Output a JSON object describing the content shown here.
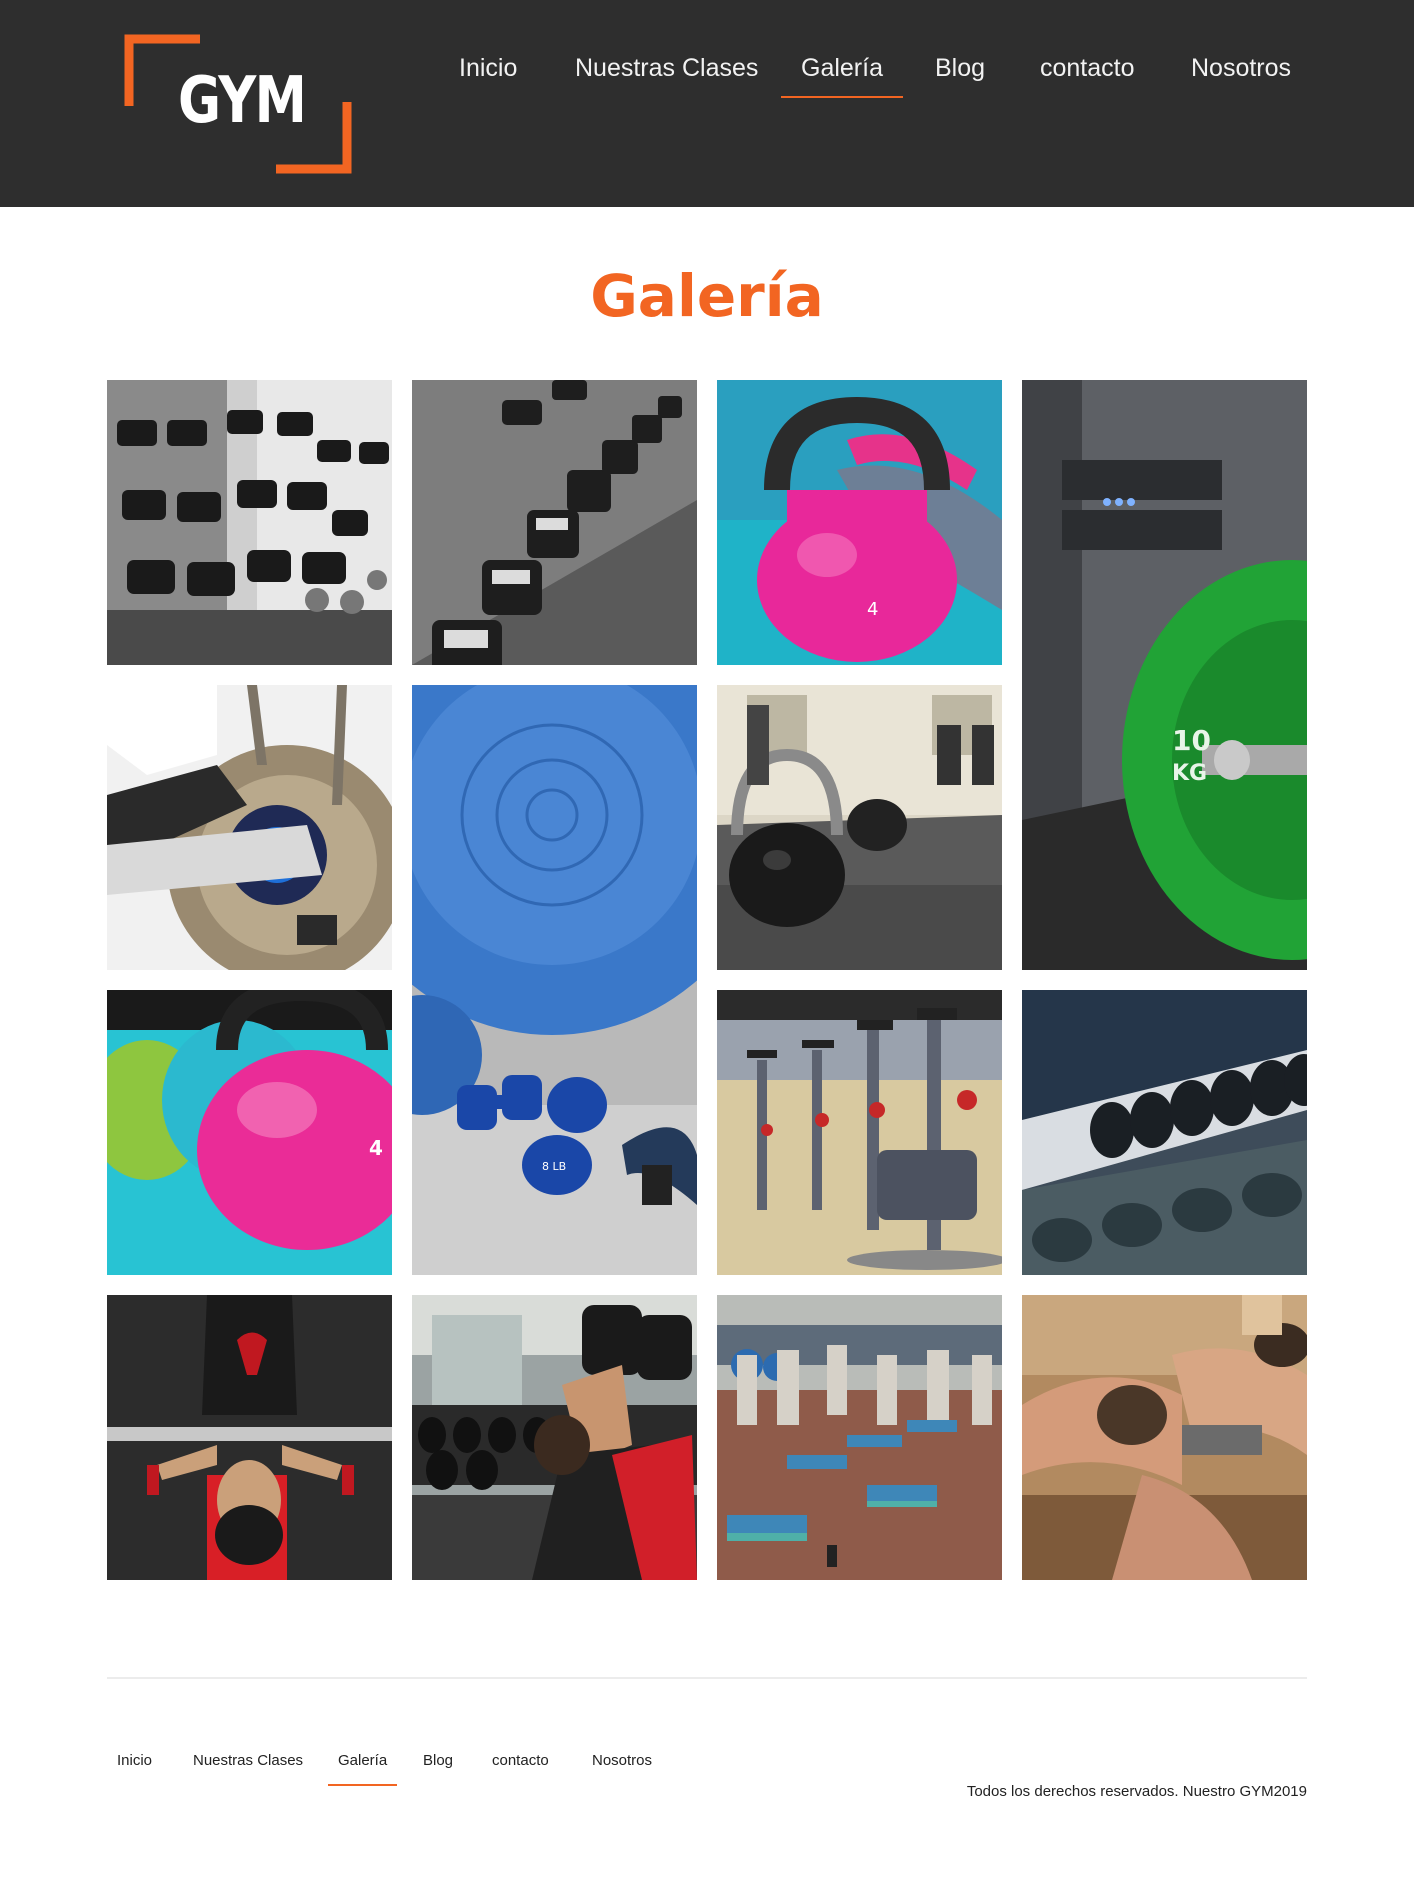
{
  "brand": {
    "logo_text": "GYM",
    "accent_color": "#f26522",
    "header_bg": "#2e2e2e"
  },
  "nav": {
    "items": [
      {
        "label": "Inicio",
        "active": false
      },
      {
        "label": "Nuestras Clases",
        "active": false
      },
      {
        "label": "Galería",
        "active": true
      },
      {
        "label": "Blog",
        "active": false
      },
      {
        "label": "contacto",
        "active": false
      },
      {
        "label": "Nosotros",
        "active": false
      }
    ]
  },
  "page": {
    "title": "Galería"
  },
  "gallery": {
    "images": [
      {
        "subject": "dumbbell rack black and white"
      },
      {
        "subject": "hex dumbbells in row"
      },
      {
        "subject": "pink kettlebell with sneaker"
      },
      {
        "subject": "green 10 kg weight plate on barbell"
      },
      {
        "subject": "elliptical trainer pedal"
      },
      {
        "subject": "blue exercise ball with dumbbells"
      },
      {
        "subject": "black kettlebells on gym floor"
      },
      {
        "subject": "colorful kettlebells"
      },
      {
        "subject": "spinning bikes"
      },
      {
        "subject": "dumbbell rack close-up"
      },
      {
        "subject": "woman bench pressing"
      },
      {
        "subject": "woman lifting dumbbell on bench"
      },
      {
        "subject": "group step class"
      },
      {
        "subject": "stretching class"
      }
    ]
  },
  "footer": {
    "nav": [
      {
        "label": "Inicio",
        "active": false
      },
      {
        "label": "Nuestras Clases",
        "active": false
      },
      {
        "label": "Galería",
        "active": true
      },
      {
        "label": "Blog",
        "active": false
      },
      {
        "label": "contacto",
        "active": false
      },
      {
        "label": "Nosotros",
        "active": false
      }
    ],
    "copyright": "Todos los derechos reservados. Nuestro GYM2019"
  }
}
